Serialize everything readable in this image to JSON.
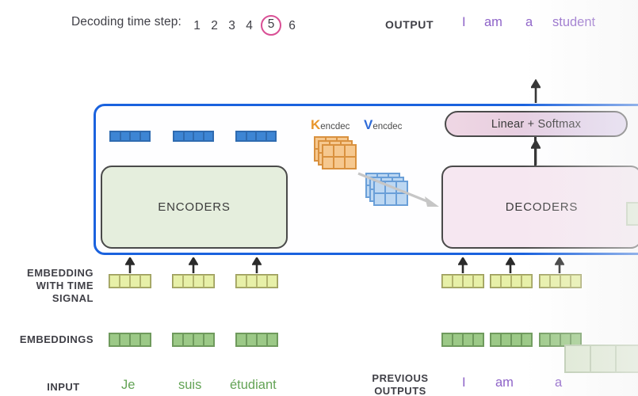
{
  "header": {
    "decoding_label": "Decoding time step:",
    "steps": [
      "1",
      "2",
      "3",
      "4",
      "5",
      "6"
    ],
    "active_step": "5",
    "output_label": "OUTPUT",
    "output_words": [
      "I",
      "am",
      "a",
      "student"
    ]
  },
  "diagram": {
    "encoders_label": "ENCODERS",
    "decoders_label": "DECODERS",
    "linear_softmax_label": "Linear + Softmax",
    "k_encdec": {
      "letter": "K",
      "subscript": "encdec"
    },
    "v_encdec": {
      "letter": "V",
      "subscript": "encdec"
    }
  },
  "rows": {
    "embedding_time_signal_label": [
      "EMBEDDING",
      "WITH TIME",
      "SIGNAL"
    ],
    "embeddings_label": "EMBEDDINGS",
    "input_label": "INPUT",
    "previous_outputs_label": [
      "PREVIOUS",
      "OUTPUTS"
    ],
    "input_words": [
      "Je",
      "suis",
      "étudiant"
    ],
    "previous_output_words": [
      "I",
      "am",
      "a"
    ]
  },
  "colors": {
    "frame_blue": "#1a62de",
    "encoder_green": "#e5eedd",
    "decoder_pink": "#f6e7f1",
    "input_word_green": "#63a355",
    "output_word_purple": "#8e63c8",
    "highlight_pink": "#d94f95",
    "k_orange": "#f6c88f",
    "v_blue": "#bcd7f2",
    "vector_blue": "#3d85d4",
    "vector_yellowgreen": "#e7f0a8",
    "vector_green": "#9cc987"
  },
  "vectors": {
    "cells_per_vector": 4,
    "encoder_blue_outputs": 3,
    "encoder_time_signal": 3,
    "encoder_embeddings": 3,
    "decoder_time_signal": 3,
    "decoder_embeddings": 3
  }
}
